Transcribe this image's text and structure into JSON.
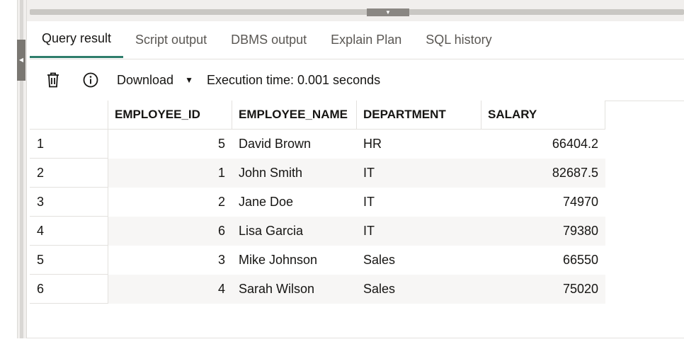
{
  "tabs": [
    {
      "label": "Query result",
      "active": true
    },
    {
      "label": "Script output",
      "active": false
    },
    {
      "label": "DBMS output",
      "active": false
    },
    {
      "label": "Explain Plan",
      "active": false
    },
    {
      "label": "SQL history",
      "active": false
    }
  ],
  "toolbar": {
    "delete_icon": "trash-icon",
    "info_icon": "info-icon",
    "download_label": "Download",
    "execution_time": "Execution time: 0.001 seconds"
  },
  "table": {
    "columns": [
      "EMPLOYEE_ID",
      "EMPLOYEE_NAME",
      "DEPARTMENT",
      "SALARY"
    ],
    "rows": [
      {
        "n": "1",
        "id": "5",
        "name": "David Brown",
        "dept": "HR",
        "salary": "66404.2"
      },
      {
        "n": "2",
        "id": "1",
        "name": "John Smith",
        "dept": "IT",
        "salary": "82687.5"
      },
      {
        "n": "3",
        "id": "2",
        "name": "Jane Doe",
        "dept": "IT",
        "salary": "74970"
      },
      {
        "n": "4",
        "id": "6",
        "name": "Lisa Garcia",
        "dept": "IT",
        "salary": "79380"
      },
      {
        "n": "5",
        "id": "3",
        "name": "Mike Johnson",
        "dept": "Sales",
        "salary": "66550"
      },
      {
        "n": "6",
        "id": "4",
        "name": "Sarah Wilson",
        "dept": "Sales",
        "salary": "75020"
      }
    ]
  },
  "colors": {
    "active_tab_underline": "#2e7d6b",
    "row_stripe": "#f7f6f5",
    "border": "#e3e1de"
  }
}
